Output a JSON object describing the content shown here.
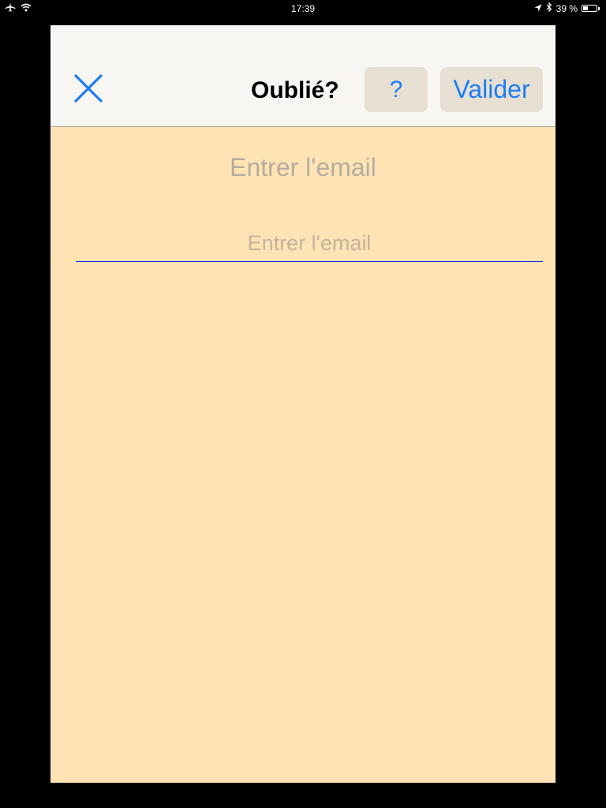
{
  "status_bar": {
    "time": "17:39",
    "battery_text": "39 %",
    "battery_level": 0.39,
    "icons": [
      "airplane-icon",
      "wifi-icon",
      "location-arrow-icon",
      "bluetooth-icon",
      "battery-icon"
    ]
  },
  "header": {
    "close_icon": "close-icon",
    "title": "Oublié?",
    "help_label": "?",
    "submit_label": "Valider"
  },
  "form": {
    "label": "Entrer l'email",
    "email_placeholder": "Entrer l'email",
    "email_value": ""
  },
  "colors": {
    "background": "#ffe3b4",
    "navbar": "#f8f6f2",
    "accent": "#1b7ef5",
    "input_underline": "#1a1ae6"
  }
}
